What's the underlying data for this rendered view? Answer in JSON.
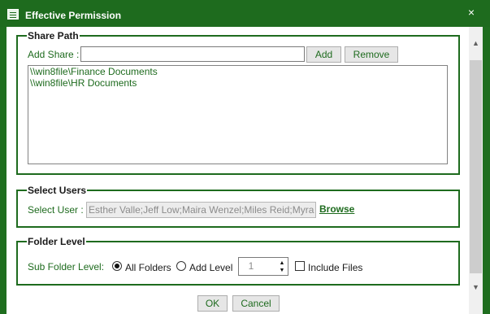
{
  "window": {
    "title": "Effective Permission"
  },
  "share_path": {
    "legend": "Share Path",
    "add_share_label": "Add Share :",
    "add_share_value": "",
    "add_button": "Add",
    "remove_button": "Remove",
    "items": [
      "\\\\win8file\\Finance Documents",
      "\\\\win8file\\HR Documents"
    ]
  },
  "select_users": {
    "legend": "Select Users",
    "select_user_label": "Select User :",
    "users_value": "Esther Valle;Jeff Low;Maira Wenzel;Miles Reid;Myra",
    "browse_link": "Browse"
  },
  "folder_level": {
    "legend": "Folder Level",
    "sub_folder_label": "Sub Folder Level:",
    "all_folders_label": "All Folders",
    "all_folders_checked": true,
    "add_level_label": "Add Level",
    "add_level_checked": false,
    "level_value": "1",
    "include_files_label": "Include Files",
    "include_files_checked": false
  },
  "footer": {
    "ok_button": "OK",
    "cancel_button": "Cancel"
  }
}
